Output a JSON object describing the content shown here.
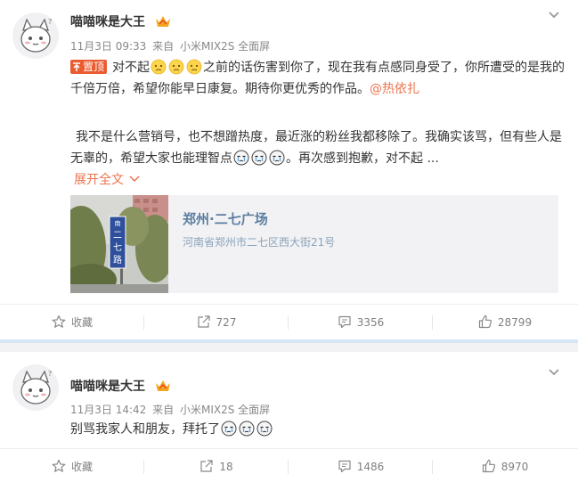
{
  "post1": {
    "author": "喵喵咪是大王",
    "date": "11月3日 09:33",
    "from": "来自",
    "device": "小米MIX2S 全面屏",
    "pin_label": "置顶",
    "text_a": "对不起",
    "text_b": "之前的话伤害到你了，现在我有点感同身受了，你所遭受的是我的千倍万倍，希望你能早日康复。期待你更优秀的作品。",
    "mention": "@热依扎",
    "paragraph2": "我不是什么营销号，也不想蹭热度，最近涨的粉丝我都移除了。我确实该骂，但有些人是无辜的，希望大家也能理智点",
    "paragraph2_tail": "。再次感到抱歉，对不起 ...",
    "expand_label": "展开全文",
    "location_title": "郑州·二七广场",
    "location_address": "河南省郑州市二七区西大街21号",
    "sign_text": "南二七路",
    "actions": {
      "favorite": "收藏",
      "repost": "727",
      "comment": "3356",
      "like": "28799"
    }
  },
  "post2": {
    "author": "喵喵咪是大王",
    "date": "11月3日 14:42",
    "from": "来自",
    "device": "小米MIX2S 全面屏",
    "text": "别骂我家人和朋友，拜托了",
    "actions": {
      "favorite": "收藏",
      "repost": "18",
      "comment": "1486",
      "like": "8970"
    }
  },
  "icons": {
    "avatar": "cat-avatar",
    "crown": "crown-badge-icon",
    "menu": "chevron-down-icon",
    "pin": "pin-icon",
    "emoji_sad": "sad-face-emoji",
    "emoji_cry": "crying-face-emoji",
    "favorite": "star-icon",
    "repost": "repost-icon",
    "comment": "comment-icon",
    "like": "thumbs-up-icon"
  },
  "colors": {
    "accent": "#eb7350",
    "pin_bg": "#eb5b30",
    "location_title": "#5c7ea0"
  }
}
